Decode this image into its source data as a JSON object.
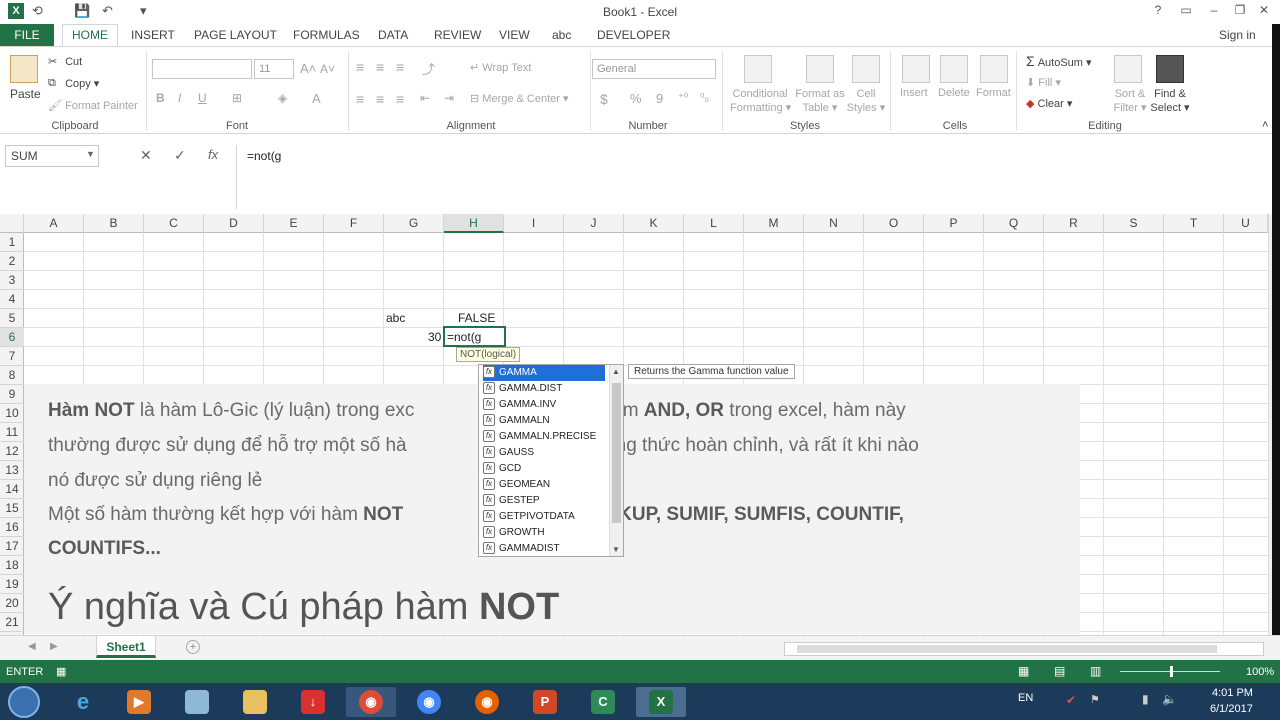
{
  "window": {
    "title": "Book1 - Excel",
    "help": "?",
    "sign_in": "Sign in"
  },
  "tabs": [
    "FILE",
    "HOME",
    "INSERT",
    "PAGE LAYOUT",
    "FORMULAS",
    "DATA",
    "REVIEW",
    "VIEW",
    "abc",
    "DEVELOPER"
  ],
  "ribbon": {
    "clipboard": {
      "paste": "Paste",
      "cut": "Cut",
      "copy": "Copy",
      "format_painter": "Format Painter",
      "label": "Clipboard"
    },
    "font": {
      "size": "11",
      "bold": "B",
      "italic": "I",
      "underline": "U",
      "label": "Font"
    },
    "alignment": {
      "wrap": "Wrap Text",
      "merge": "Merge & Center",
      "label": "Alignment"
    },
    "number": {
      "format": "General",
      "currency": "$",
      "percent": "%",
      "comma": "9",
      "label": "Number"
    },
    "styles": {
      "conditional": "Conditional",
      "conditional2": "Formatting",
      "format_as": "Format as",
      "format_as2": "Table",
      "cell": "Cell",
      "cell2": "Styles",
      "label": "Styles"
    },
    "cells": {
      "insert": "Insert",
      "delete": "Delete",
      "format": "Format",
      "label": "Cells"
    },
    "editing": {
      "autosum": "AutoSum",
      "fill": "Fill",
      "clear": "Clear",
      "sort": "Sort &",
      "sort2": "Filter",
      "find": "Find &",
      "find2": "Select",
      "label": "Editing"
    }
  },
  "formula_bar": {
    "name_box": "SUM",
    "cancel": "✕",
    "enter": "✓",
    "fx": "fx",
    "formula": "=not(g"
  },
  "columns": [
    "A",
    "B",
    "C",
    "D",
    "E",
    "F",
    "G",
    "H",
    "I",
    "J",
    "K",
    "L",
    "M",
    "N",
    "O",
    "P",
    "Q",
    "R",
    "S",
    "T",
    "U"
  ],
  "rows": [
    "1",
    "2",
    "3",
    "4",
    "5",
    "6",
    "7",
    "8",
    "9",
    "10",
    "11",
    "12",
    "13",
    "14",
    "15",
    "16",
    "17",
    "18",
    "19",
    "20",
    "21"
  ],
  "cells": {
    "G5": "abc",
    "H5": "FALSE",
    "G6": "30",
    "H6": "=not(g"
  },
  "arg_tip": "NOT(logical)",
  "autocomplete": {
    "items": [
      "GAMMA",
      "GAMMA.DIST",
      "GAMMA.INV",
      "GAMMALN",
      "GAMMALN.PRECISE",
      "GAUSS",
      "GCD",
      "GEOMEAN",
      "GESTEP",
      "GETPIVOTDATA",
      "GROWTH",
      "GAMMADIST"
    ],
    "tooltip": "Returns the Gamma function value"
  },
  "overlay": {
    "l1a": "Hàm NOT",
    "l1b": " là hàm Lô-Gic (lý luận) trong exc",
    "l1c": "như hàm ",
    "l1d": "AND, OR",
    "l1e": " trong excel, hàm này",
    "l2a": "thường được sử dụng để hỗ trợ một số hà",
    "l2b": "một công thức hoàn chỉnh, và rất ít khi nào",
    "l3": "nó được sử dụng riêng lẻ",
    "l4a": "Một số hàm thường kết hợp với hàm ",
    "l4b": "NOT",
    "l4c": "HLOOKUP, SUMIF, SUMFIS, COUNTIF,",
    "l5": "COUNTIFS...",
    "title_a": "Ý nghĩa và Cú pháp hàm ",
    "title_b": "NOT"
  },
  "sheet": {
    "tab": "Sheet1"
  },
  "status": {
    "mode": "ENTER",
    "zoom": "100%"
  },
  "taskbar": {
    "lang": "EN",
    "time": "4:01 PM",
    "date": "6/1/2017"
  }
}
